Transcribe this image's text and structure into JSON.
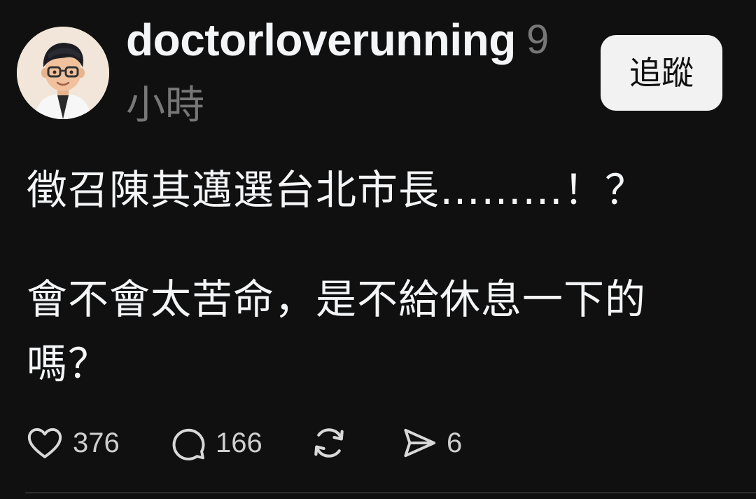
{
  "post": {
    "author": {
      "username": "doctorloverunning",
      "time_number": "9",
      "time_unit": "小時",
      "avatar_icon": "avatar-cartoon-doctor"
    },
    "follow_label": "追蹤",
    "body": {
      "line1": "徵召陳其邁選台北市長………！？",
      "line2": "會不會太苦命，是不給休息一下的",
      "line3": "嗎？"
    },
    "actions": {
      "likes": "376",
      "replies": "166",
      "shares": "6"
    }
  },
  "colors": {
    "background": "#101010",
    "text": "#f3f5f7",
    "muted": "#777777",
    "button_bg": "#f2f2f2"
  }
}
